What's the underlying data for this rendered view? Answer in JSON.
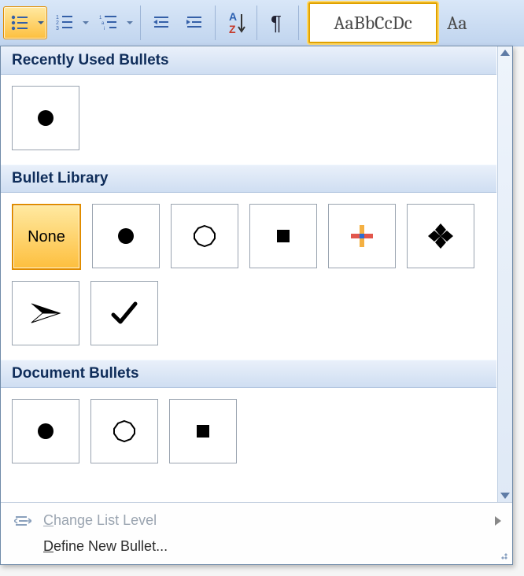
{
  "ribbon": {
    "bullets_tooltip": "Bullets",
    "numbering_tooltip": "Numbering",
    "multilevel_tooltip": "Multilevel List",
    "dec_indent_tooltip": "Decrease Indent",
    "inc_indent_tooltip": "Increase Indent",
    "sort_tooltip": "Sort",
    "showmarks_tooltip": "Show/Hide ¶",
    "style_preview_1": "AaBbCcDc",
    "style_preview_2": "Aa"
  },
  "gallery": {
    "sections": {
      "recent": "Recently Used Bullets",
      "library": "Bullet Library",
      "document": "Document Bullets"
    },
    "none_label": "None",
    "recent_items": [
      {
        "id": "disc",
        "icon": "disc-icon"
      }
    ],
    "library_items": [
      {
        "id": "none",
        "label": "None",
        "selected": true
      },
      {
        "id": "disc",
        "icon": "disc-icon"
      },
      {
        "id": "circle",
        "icon": "circle-icon"
      },
      {
        "id": "square",
        "icon": "square-icon"
      },
      {
        "id": "plus-color",
        "icon": "plus-color-icon"
      },
      {
        "id": "diamond4",
        "icon": "diamond4-icon"
      },
      {
        "id": "arrowhead",
        "icon": "arrowhead-icon"
      },
      {
        "id": "check",
        "icon": "check-icon"
      }
    ],
    "document_items": [
      {
        "id": "disc",
        "icon": "disc-icon"
      },
      {
        "id": "circle",
        "icon": "circle-icon"
      },
      {
        "id": "square",
        "icon": "square-icon"
      }
    ]
  },
  "menu": {
    "change_list_level": "Change List Level",
    "define_new_bullet": "Define New Bullet..."
  }
}
